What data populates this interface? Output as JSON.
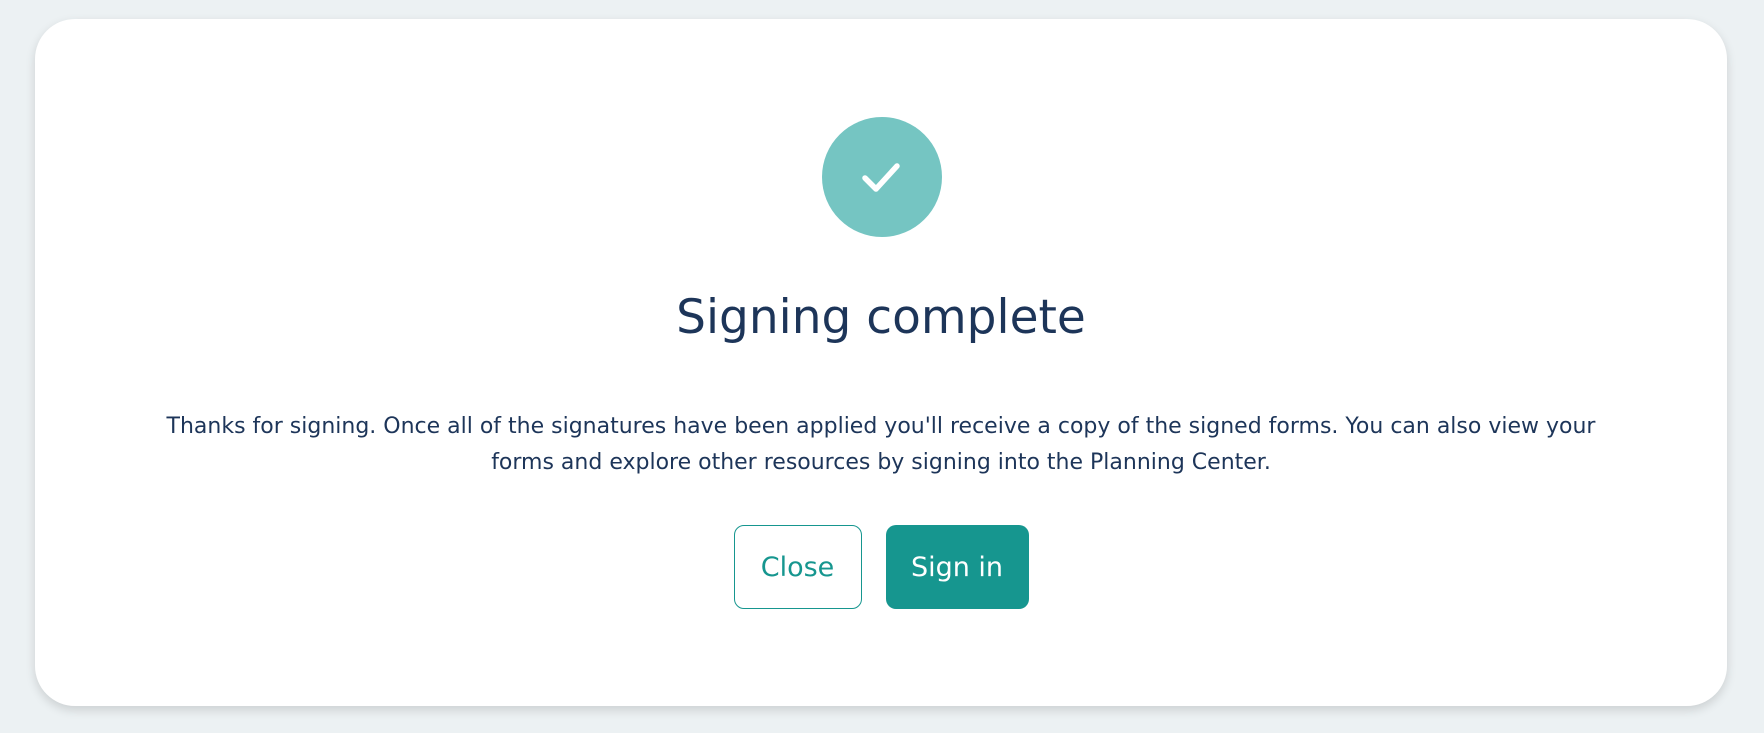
{
  "dialog": {
    "title": "Signing complete",
    "message": "Thanks for signing. Once all of the signatures have been applied you'll receive a copy of the signed forms. You can also view your forms and explore other resources by signing into the Planning Center.",
    "icon": "checkmark-icon",
    "close_label": "Close",
    "signin_label": "Sign in"
  },
  "colors": {
    "background": "#ecf1f3",
    "card": "#ffffff",
    "check_circle": "#75c5c2",
    "check_mark": "#ffffff",
    "title_text": "#1d3559",
    "body_text": "#1d3559",
    "accent": "#16968f"
  }
}
